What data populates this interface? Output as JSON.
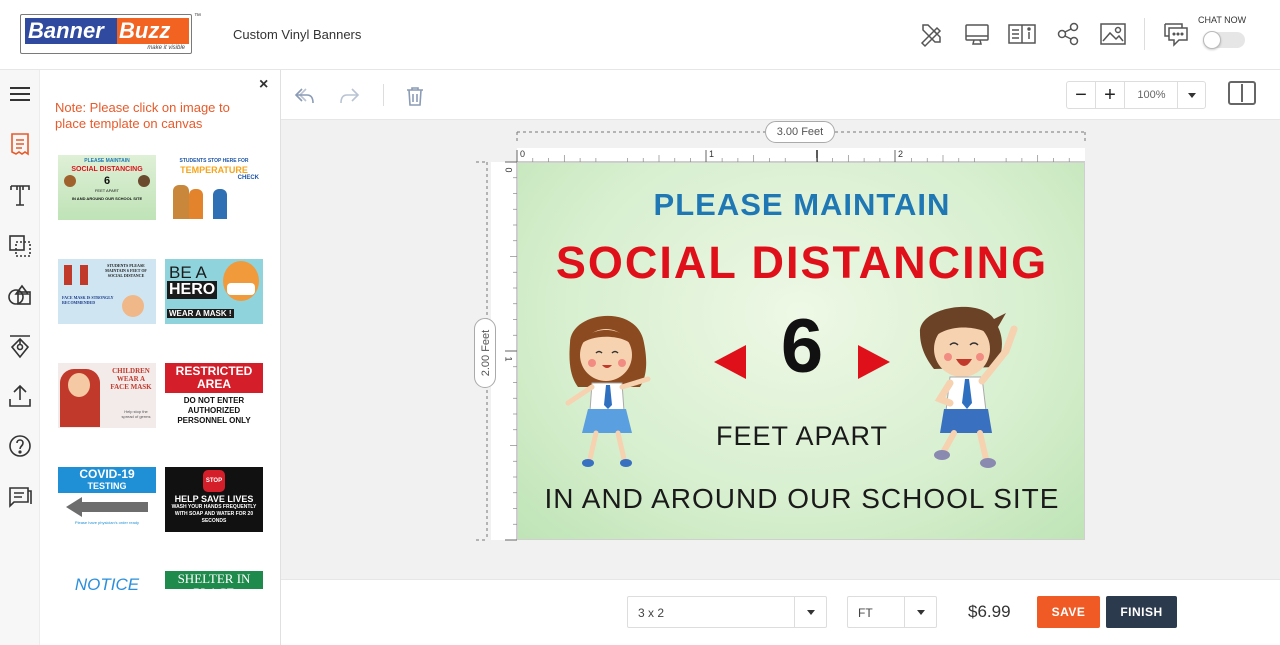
{
  "header": {
    "logo_part1": "Banner",
    "logo_part2": "Buzz",
    "logo_tagline": "make it visible",
    "trademark": "™",
    "product_name": "Custom Vinyl Banners",
    "chat_label": "CHAT NOW",
    "chat_enabled": false,
    "icons": [
      "design-tools-icon",
      "preview-monitor-icon",
      "guide-book-icon",
      "share-icon",
      "image-icon",
      "chat-icon"
    ]
  },
  "rail": {
    "icons": [
      "menu-icon",
      "templates-icon",
      "text-icon",
      "layers-icon",
      "shapes-icon",
      "clipart-icon",
      "upload-icon",
      "help-icon",
      "notes-icon"
    ],
    "active": "templates-icon",
    "accent_color": "#e85a2a"
  },
  "template_panel": {
    "close_label": "×",
    "note": "Note: Please click on image to place template on canvas",
    "templates": [
      {
        "line1": "PLEASE MAINTAIN",
        "line2": "SOCIAL DISTANCING",
        "line3": "6",
        "line4": "FEET APART",
        "line5": "IN AND AROUND OUR SCHOOL SITE"
      },
      {
        "line1": "STUDENTS STOP HERE FOR",
        "line2": "TEMPERATURE",
        "line3": "CHECK"
      },
      {
        "line1": "STUDENTS PLEASE MAINTAIN 6 FEET OF SOCIAL DISTANCE",
        "line2": "FACE MASK IS STRONGLY RECOMMENDED"
      },
      {
        "line1": "BE A",
        "line2": "HERO",
        "line3": "WEAR A MASK !"
      },
      {
        "line1": "CHILDREN WEAR A FACE MASK",
        "line2": "Help stop the spread of germs"
      },
      {
        "line1": "RESTRICTED AREA",
        "line2": "DO NOT ENTER AUTHORIZED PERSONNEL ONLY"
      },
      {
        "line1": "COVID-19",
        "line2": "TESTING",
        "line3": "Please have physician's order ready"
      },
      {
        "line1": "STOP",
        "line2": "HELP SAVE LIVES",
        "line3": "WASH YOUR HANDS FREQUENTLY WITH SOAP AND WATER FOR 20 SECONDS"
      },
      {
        "line1": "NOTICE"
      },
      {
        "line1": "SHELTER IN PLACE"
      }
    ]
  },
  "toolbar": {
    "zoom_value": "100%",
    "zoom_out_label": "−",
    "zoom_in_label": "+"
  },
  "canvas": {
    "width_label": "3.00 Feet",
    "height_label": "2.00 Feet",
    "top_ticks": [
      "0",
      "1",
      "2"
    ],
    "left_ticks": [
      "0",
      "1"
    ],
    "banner": {
      "line1": "PLEASE MAINTAIN",
      "line2": "SOCIAL DISTANCING",
      "number": "6",
      "line3": "FEET APART",
      "line4": "IN AND AROUND OUR SCHOOL SITE",
      "colors": {
        "blue": "#1f78b4",
        "red": "#e0101a",
        "dark": "#1a1a1a",
        "bg": "#dff0d6"
      }
    }
  },
  "footer": {
    "size_value": "3 x 2",
    "unit_value": "FT",
    "price": "$6.99",
    "save_label": "SAVE",
    "finish_label": "FINISH",
    "save_color": "#f05a24",
    "finish_color": "#2c3a4e"
  }
}
